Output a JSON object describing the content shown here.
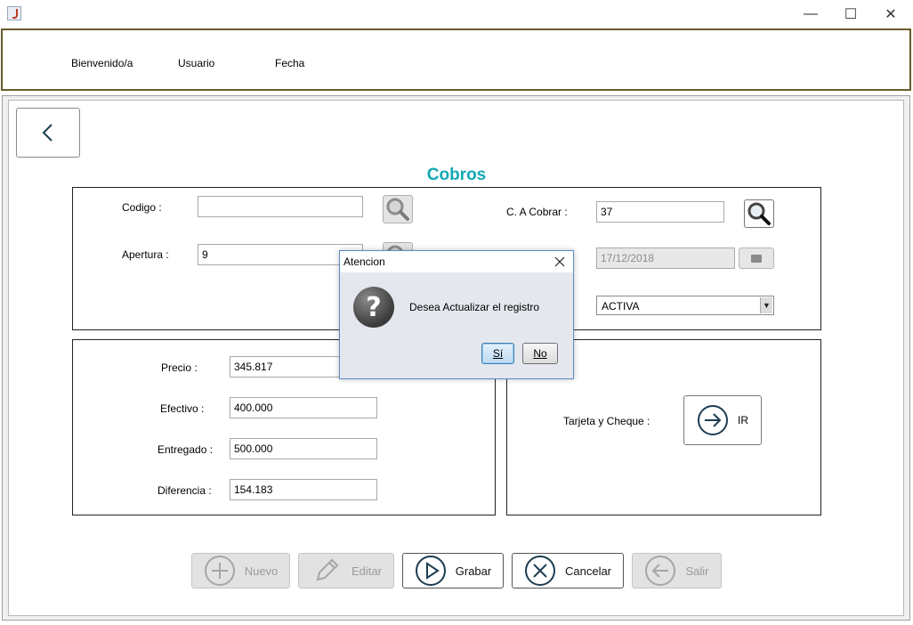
{
  "window": {
    "minimize_glyph": "—",
    "maximize_glyph": "☐",
    "close_glyph": "✕"
  },
  "header": {
    "welcome": "Bienvenido/a",
    "user": "Usuario",
    "date": "Fecha"
  },
  "title": "Cobros",
  "form": {
    "codigo_label": "Codigo :",
    "codigo_value": "",
    "apertura_label": "Apertura :",
    "apertura_value": "9",
    "cobrar_label": "C. A Cobrar :",
    "cobrar_value": "37",
    "fecha_value": "17/12/2018",
    "estado_value": "ACTIVA"
  },
  "payment": {
    "precio_label": "Precio :",
    "precio_value": "345.817",
    "efectivo_label": "Efectivo :",
    "efectivo_value": "400.000",
    "entregado_label": "Entregado :",
    "entregado_value": "500.000",
    "diferencia_label": "Diferencia :",
    "diferencia_value": "154.183",
    "tarjeta_label": "Tarjeta y Cheque :",
    "ir_label": "IR"
  },
  "actions": {
    "nuevo": "Nuevo",
    "editar": "Editar",
    "grabar": "Grabar",
    "cancelar": "Cancelar",
    "salir": "Salir"
  },
  "dialog": {
    "title": "Atencion",
    "message": "Desea Actualizar el registro",
    "yes": "Sí",
    "no": "No",
    "icon_glyph": "?"
  },
  "colors": {
    "title": "#11a8b4",
    "header_border": "#6b5a2a",
    "icon_stroke": "#1d3d52"
  }
}
